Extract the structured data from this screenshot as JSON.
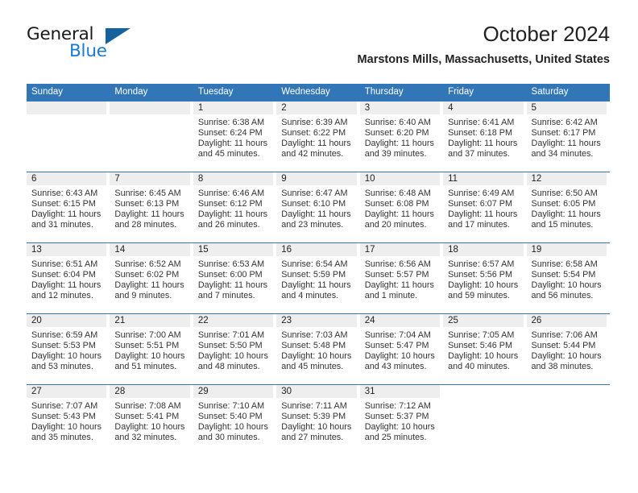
{
  "brand": {
    "name_top": "General",
    "name_bottom": "Blue",
    "triangle_icon": "triangle-icon",
    "color_black": "#1a1a1a",
    "color_blue": "#1a7ad6",
    "color_triangle": "#15639e"
  },
  "header": {
    "title": "October 2024",
    "subtitle": "Marstons Mills, Massachusetts, United States"
  },
  "theme": {
    "header_blue": "#3276b8",
    "day_band_gray": "#eeeeee",
    "text": "#222222"
  },
  "weekday_headers": [
    "Sunday",
    "Monday",
    "Tuesday",
    "Wednesday",
    "Thursday",
    "Friday",
    "Saturday"
  ],
  "weeks": [
    [
      {
        "day": "",
        "sunrise": "",
        "sunset": "",
        "daylight_line1": "",
        "daylight_line2": ""
      },
      {
        "day": "",
        "sunrise": "",
        "sunset": "",
        "daylight_line1": "",
        "daylight_line2": ""
      },
      {
        "day": "1",
        "sunrise": "Sunrise: 6:38 AM",
        "sunset": "Sunset: 6:24 PM",
        "daylight_line1": "Daylight: 11 hours",
        "daylight_line2": "and 45 minutes."
      },
      {
        "day": "2",
        "sunrise": "Sunrise: 6:39 AM",
        "sunset": "Sunset: 6:22 PM",
        "daylight_line1": "Daylight: 11 hours",
        "daylight_line2": "and 42 minutes."
      },
      {
        "day": "3",
        "sunrise": "Sunrise: 6:40 AM",
        "sunset": "Sunset: 6:20 PM",
        "daylight_line1": "Daylight: 11 hours",
        "daylight_line2": "and 39 minutes."
      },
      {
        "day": "4",
        "sunrise": "Sunrise: 6:41 AM",
        "sunset": "Sunset: 6:18 PM",
        "daylight_line1": "Daylight: 11 hours",
        "daylight_line2": "and 37 minutes."
      },
      {
        "day": "5",
        "sunrise": "Sunrise: 6:42 AM",
        "sunset": "Sunset: 6:17 PM",
        "daylight_line1": "Daylight: 11 hours",
        "daylight_line2": "and 34 minutes."
      }
    ],
    [
      {
        "day": "6",
        "sunrise": "Sunrise: 6:43 AM",
        "sunset": "Sunset: 6:15 PM",
        "daylight_line1": "Daylight: 11 hours",
        "daylight_line2": "and 31 minutes."
      },
      {
        "day": "7",
        "sunrise": "Sunrise: 6:45 AM",
        "sunset": "Sunset: 6:13 PM",
        "daylight_line1": "Daylight: 11 hours",
        "daylight_line2": "and 28 minutes."
      },
      {
        "day": "8",
        "sunrise": "Sunrise: 6:46 AM",
        "sunset": "Sunset: 6:12 PM",
        "daylight_line1": "Daylight: 11 hours",
        "daylight_line2": "and 26 minutes."
      },
      {
        "day": "9",
        "sunrise": "Sunrise: 6:47 AM",
        "sunset": "Sunset: 6:10 PM",
        "daylight_line1": "Daylight: 11 hours",
        "daylight_line2": "and 23 minutes."
      },
      {
        "day": "10",
        "sunrise": "Sunrise: 6:48 AM",
        "sunset": "Sunset: 6:08 PM",
        "daylight_line1": "Daylight: 11 hours",
        "daylight_line2": "and 20 minutes."
      },
      {
        "day": "11",
        "sunrise": "Sunrise: 6:49 AM",
        "sunset": "Sunset: 6:07 PM",
        "daylight_line1": "Daylight: 11 hours",
        "daylight_line2": "and 17 minutes."
      },
      {
        "day": "12",
        "sunrise": "Sunrise: 6:50 AM",
        "sunset": "Sunset: 6:05 PM",
        "daylight_line1": "Daylight: 11 hours",
        "daylight_line2": "and 15 minutes."
      }
    ],
    [
      {
        "day": "13",
        "sunrise": "Sunrise: 6:51 AM",
        "sunset": "Sunset: 6:04 PM",
        "daylight_line1": "Daylight: 11 hours",
        "daylight_line2": "and 12 minutes."
      },
      {
        "day": "14",
        "sunrise": "Sunrise: 6:52 AM",
        "sunset": "Sunset: 6:02 PM",
        "daylight_line1": "Daylight: 11 hours",
        "daylight_line2": "and 9 minutes."
      },
      {
        "day": "15",
        "sunrise": "Sunrise: 6:53 AM",
        "sunset": "Sunset: 6:00 PM",
        "daylight_line1": "Daylight: 11 hours",
        "daylight_line2": "and 7 minutes."
      },
      {
        "day": "16",
        "sunrise": "Sunrise: 6:54 AM",
        "sunset": "Sunset: 5:59 PM",
        "daylight_line1": "Daylight: 11 hours",
        "daylight_line2": "and 4 minutes."
      },
      {
        "day": "17",
        "sunrise": "Sunrise: 6:56 AM",
        "sunset": "Sunset: 5:57 PM",
        "daylight_line1": "Daylight: 11 hours",
        "daylight_line2": "and 1 minute."
      },
      {
        "day": "18",
        "sunrise": "Sunrise: 6:57 AM",
        "sunset": "Sunset: 5:56 PM",
        "daylight_line1": "Daylight: 10 hours",
        "daylight_line2": "and 59 minutes."
      },
      {
        "day": "19",
        "sunrise": "Sunrise: 6:58 AM",
        "sunset": "Sunset: 5:54 PM",
        "daylight_line1": "Daylight: 10 hours",
        "daylight_line2": "and 56 minutes."
      }
    ],
    [
      {
        "day": "20",
        "sunrise": "Sunrise: 6:59 AM",
        "sunset": "Sunset: 5:53 PM",
        "daylight_line1": "Daylight: 10 hours",
        "daylight_line2": "and 53 minutes."
      },
      {
        "day": "21",
        "sunrise": "Sunrise: 7:00 AM",
        "sunset": "Sunset: 5:51 PM",
        "daylight_line1": "Daylight: 10 hours",
        "daylight_line2": "and 51 minutes."
      },
      {
        "day": "22",
        "sunrise": "Sunrise: 7:01 AM",
        "sunset": "Sunset: 5:50 PM",
        "daylight_line1": "Daylight: 10 hours",
        "daylight_line2": "and 48 minutes."
      },
      {
        "day": "23",
        "sunrise": "Sunrise: 7:03 AM",
        "sunset": "Sunset: 5:48 PM",
        "daylight_line1": "Daylight: 10 hours",
        "daylight_line2": "and 45 minutes."
      },
      {
        "day": "24",
        "sunrise": "Sunrise: 7:04 AM",
        "sunset": "Sunset: 5:47 PM",
        "daylight_line1": "Daylight: 10 hours",
        "daylight_line2": "and 43 minutes."
      },
      {
        "day": "25",
        "sunrise": "Sunrise: 7:05 AM",
        "sunset": "Sunset: 5:46 PM",
        "daylight_line1": "Daylight: 10 hours",
        "daylight_line2": "and 40 minutes."
      },
      {
        "day": "26",
        "sunrise": "Sunrise: 7:06 AM",
        "sunset": "Sunset: 5:44 PM",
        "daylight_line1": "Daylight: 10 hours",
        "daylight_line2": "and 38 minutes."
      }
    ],
    [
      {
        "day": "27",
        "sunrise": "Sunrise: 7:07 AM",
        "sunset": "Sunset: 5:43 PM",
        "daylight_line1": "Daylight: 10 hours",
        "daylight_line2": "and 35 minutes."
      },
      {
        "day": "28",
        "sunrise": "Sunrise: 7:08 AM",
        "sunset": "Sunset: 5:41 PM",
        "daylight_line1": "Daylight: 10 hours",
        "daylight_line2": "and 32 minutes."
      },
      {
        "day": "29",
        "sunrise": "Sunrise: 7:10 AM",
        "sunset": "Sunset: 5:40 PM",
        "daylight_line1": "Daylight: 10 hours",
        "daylight_line2": "and 30 minutes."
      },
      {
        "day": "30",
        "sunrise": "Sunrise: 7:11 AM",
        "sunset": "Sunset: 5:39 PM",
        "daylight_line1": "Daylight: 10 hours",
        "daylight_line2": "and 27 minutes."
      },
      {
        "day": "31",
        "sunrise": "Sunrise: 7:12 AM",
        "sunset": "Sunset: 5:37 PM",
        "daylight_line1": "Daylight: 10 hours",
        "daylight_line2": "and 25 minutes."
      },
      {
        "day": "",
        "sunrise": "",
        "sunset": "",
        "daylight_line1": "",
        "daylight_line2": ""
      },
      {
        "day": "",
        "sunrise": "",
        "sunset": "",
        "daylight_line1": "",
        "daylight_line2": ""
      }
    ]
  ]
}
